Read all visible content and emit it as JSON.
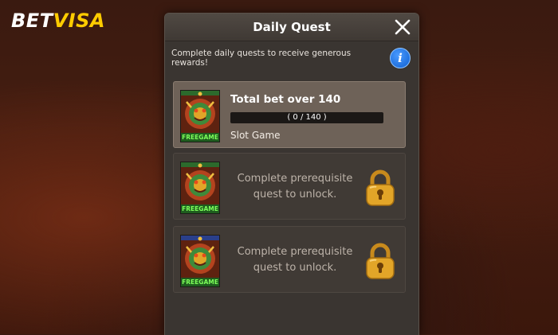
{
  "brand": {
    "part1": "BET",
    "part2": "VISA"
  },
  "dialog": {
    "title": "Daily Quest",
    "description": "Complete daily quests to receive generous rewards!"
  },
  "quests": [
    {
      "badge": "FREEGAME",
      "title": "Total bet over 140",
      "progress_text": "( 0 / 140 )",
      "progress_value": 0,
      "progress_max": 140,
      "category": "Slot Game"
    },
    {
      "badge": "FREEGAME",
      "locked_text": "Complete prerequisite quest to unlock."
    },
    {
      "badge": "FREEGAME",
      "locked_text": "Complete prerequisite quest to unlock."
    }
  ],
  "colors": {
    "brand_yellow": "#ffcc00",
    "panel_bg": "#3a3531",
    "active_card": "#6e6258",
    "locked_card": "#403a35",
    "info_blue": "#1a6fe0",
    "lock_gold": "#e2a528",
    "freegame_green": "#7dff5a"
  },
  "icons": [
    "close-icon",
    "info-icon",
    "lock-icon",
    "dragon-slot-icon"
  ]
}
